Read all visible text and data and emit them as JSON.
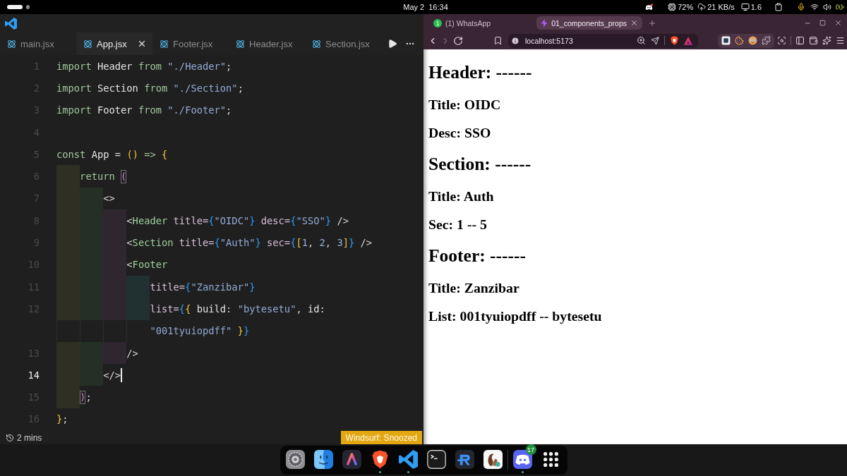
{
  "system_bar": {
    "workspaces": [
      {
        "selected": true
      },
      {
        "selected": false
      }
    ],
    "date": "May 2",
    "time": "16:34",
    "cpu": "72%",
    "network": "21 KB/s",
    "load": "1.6"
  },
  "editor": {
    "tabs": [
      {
        "label": "main.jsx",
        "selected": false
      },
      {
        "label": "App.jsx",
        "selected": true
      },
      {
        "label": "Footer.jsx",
        "selected": false
      },
      {
        "label": "Header.jsx",
        "selected": false
      },
      {
        "label": "Section.jsx",
        "selected": false
      }
    ],
    "lines": [
      {
        "number": "1",
        "current": false,
        "tokens": [
          {
            "kind": "keyword",
            "text": "import"
          },
          {
            "kind": "name",
            "text": " Header "
          },
          {
            "kind": "keyword",
            "text": "from"
          },
          {
            "kind": "string",
            "text": " \"./Header\""
          },
          {
            "kind": "punct",
            "text": ";"
          }
        ]
      },
      {
        "number": "2",
        "current": false,
        "tokens": [
          {
            "kind": "keyword",
            "text": "import"
          },
          {
            "kind": "name",
            "text": " Section "
          },
          {
            "kind": "keyword",
            "text": "from"
          },
          {
            "kind": "string",
            "text": " \"./Section\""
          },
          {
            "kind": "punct",
            "text": ";"
          }
        ]
      },
      {
        "number": "3",
        "current": false,
        "tokens": [
          {
            "kind": "keyword",
            "text": "import"
          },
          {
            "kind": "name",
            "text": " Footer "
          },
          {
            "kind": "keyword",
            "text": "from"
          },
          {
            "kind": "string",
            "text": " \"./Footer\""
          },
          {
            "kind": "punct",
            "text": ";"
          }
        ]
      },
      {
        "number": "4",
        "current": false
      },
      {
        "number": "5",
        "current": false,
        "tokens": [
          {
            "kind": "keyword",
            "text": "const"
          },
          {
            "kind": "name",
            "text": " App "
          },
          {
            "kind": "punct",
            "text": "= "
          },
          {
            "kind": "bracket1",
            "text": "()"
          },
          {
            "kind": "keyword",
            "text": " => "
          },
          {
            "kind": "bracket1",
            "text": "{"
          }
        ]
      },
      {
        "number": "6",
        "current": false,
        "guides": [
          {
            "color": "#2f2f23"
          }
        ],
        "tokens": [
          {
            "kind": "keyword",
            "text": "return "
          },
          {
            "kind": "match",
            "text": "("
          }
        ]
      },
      {
        "number": "7",
        "current": false,
        "guides": [
          {
            "color": "#2f2f23"
          },
          {
            "color": "#243026"
          }
        ],
        "tokens": [
          {
            "kind": "punct",
            "text": "<>"
          }
        ]
      },
      {
        "number": "8",
        "current": false,
        "guides": [
          {
            "color": "#2f2f23"
          },
          {
            "color": "#243026"
          },
          {
            "color": "#2f2630"
          }
        ],
        "tokens": [
          {
            "kind": "punct",
            "text": "<"
          },
          {
            "kind": "tag",
            "text": "Header"
          },
          {
            "kind": "attr",
            "text": " title="
          },
          {
            "kind": "bracket3",
            "text": "{"
          },
          {
            "kind": "string",
            "text": "\"OIDC\""
          },
          {
            "kind": "bracket3",
            "text": "}"
          },
          {
            "kind": "attr",
            "text": " desc="
          },
          {
            "kind": "bracket3",
            "text": "{"
          },
          {
            "kind": "string",
            "text": "\"SSO\""
          },
          {
            "kind": "bracket3",
            "text": "}"
          },
          {
            "kind": "punct",
            "text": " />"
          }
        ]
      },
      {
        "number": "9",
        "current": false,
        "guides": [
          {
            "color": "#2f2f23"
          },
          {
            "color": "#243026"
          },
          {
            "color": "#2f2630"
          }
        ],
        "tokens": [
          {
            "kind": "punct",
            "text": "<"
          },
          {
            "kind": "tag",
            "text": "Section"
          },
          {
            "kind": "attr",
            "text": " title="
          },
          {
            "kind": "bracket3",
            "text": "{"
          },
          {
            "kind": "string",
            "text": "\"Auth\""
          },
          {
            "kind": "bracket3",
            "text": "}"
          },
          {
            "kind": "attr",
            "text": " sec="
          },
          {
            "kind": "bracket3",
            "text": "{"
          },
          {
            "kind": "bracket1",
            "text": "["
          },
          {
            "kind": "number",
            "text": "1"
          },
          {
            "kind": "punct",
            "text": ", "
          },
          {
            "kind": "number",
            "text": "2"
          },
          {
            "kind": "punct",
            "text": ", "
          },
          {
            "kind": "number",
            "text": "3"
          },
          {
            "kind": "bracket1",
            "text": "]"
          },
          {
            "kind": "bracket3",
            "text": "}"
          },
          {
            "kind": "punct",
            "text": " />"
          }
        ]
      },
      {
        "number": "10",
        "current": false,
        "guides": [
          {
            "color": "#2f2f23"
          },
          {
            "color": "#243026"
          },
          {
            "color": "#2f2630"
          }
        ],
        "tokens": [
          {
            "kind": "punct",
            "text": "<"
          },
          {
            "kind": "tag",
            "text": "Footer"
          }
        ]
      },
      {
        "number": "11",
        "current": false,
        "guides": [
          {
            "color": "#2f2f23"
          },
          {
            "color": "#243026"
          },
          {
            "color": "#2f2630"
          },
          {
            "color": "#213030"
          }
        ],
        "tokens": [
          {
            "kind": "attr",
            "text": "title="
          },
          {
            "kind": "bracket3",
            "text": "{"
          },
          {
            "kind": "string",
            "text": "\"Zanzibar\""
          },
          {
            "kind": "bracket3",
            "text": "}"
          }
        ]
      },
      {
        "number": "12",
        "current": false,
        "guides": [
          {
            "color": "#2f2f23"
          },
          {
            "color": "#243026"
          },
          {
            "color": "#2f2630"
          },
          {
            "color": "#213030"
          }
        ],
        "tokens": [
          {
            "kind": "attr",
            "text": "list="
          },
          {
            "kind": "bracket3",
            "text": "{"
          },
          {
            "kind": "bracket1",
            "text": "{"
          },
          {
            "kind": "name",
            "text": " build"
          },
          {
            "kind": "punct",
            "text": ": "
          },
          {
            "kind": "string",
            "text": "\"bytesetu\""
          },
          {
            "kind": "punct",
            "text": ", "
          },
          {
            "kind": "name",
            "text": "id"
          },
          {
            "kind": "punct",
            "text": ":"
          }
        ],
        "wrap": [
          {
            "kind": "string",
            "text": "\"001tyuiopdff\""
          },
          {
            "kind": "bracket1",
            "text": " }"
          },
          {
            "kind": "bracket3",
            "text": "}"
          }
        ]
      },
      {
        "number": "13",
        "current": false,
        "guides": [
          {
            "color": "#2f2f23"
          },
          {
            "color": "#243026"
          },
          {
            "color": "#2f2630"
          }
        ],
        "tokens": [
          {
            "kind": "punct",
            "text": "/>"
          }
        ]
      },
      {
        "number": "14",
        "current": true,
        "guides": [
          {
            "color": "#2f2f23"
          },
          {
            "color": "#243026"
          }
        ],
        "tokens": [
          {
            "kind": "punct",
            "text": "</>"
          }
        ]
      },
      {
        "number": "15",
        "current": false,
        "guides": [
          {
            "color": "#2f2f23"
          }
        ],
        "tokens": [
          {
            "kind": "match",
            "text": ")"
          },
          {
            "kind": "punct",
            "text": ";"
          }
        ]
      },
      {
        "number": "16",
        "current": false,
        "tokens": [
          {
            "kind": "bracket1",
            "text": "}"
          },
          {
            "kind": "punct",
            "text": ";"
          }
        ]
      }
    ],
    "status": {
      "history": "2 mins",
      "badge": "Windsurf: Snoozed"
    }
  },
  "browser": {
    "tabs": [
      {
        "title": "(1) WhatsApp",
        "badge": "1",
        "selected": false
      },
      {
        "title": "01_components_props",
        "selected": true
      }
    ],
    "nav_buttons": [
      {
        "kind": "back",
        "disabled": false
      },
      {
        "kind": "forward",
        "disabled": true
      },
      {
        "kind": "reload",
        "disabled": false
      }
    ],
    "url": "localhost:5173",
    "page": [
      {
        "kind": "heading",
        "text": "Header: ------"
      },
      {
        "kind": "field",
        "text": "Title: OIDC"
      },
      {
        "kind": "field",
        "text": "Desc: SSO"
      },
      {
        "kind": "heading",
        "text": "Section: ------"
      },
      {
        "kind": "field",
        "text": "Title: Auth"
      },
      {
        "kind": "field",
        "text": "Sec: 1 -- 5"
      },
      {
        "kind": "heading",
        "text": "Footer: ------"
      },
      {
        "kind": "field",
        "text": "Title: Zanzibar"
      },
      {
        "kind": "field",
        "text": "List: 001tyuiopdff -- bytesetu"
      }
    ]
  },
  "dock": {
    "apps": [
      {
        "kind": "settings",
        "running": false
      },
      {
        "kind": "files",
        "running": false
      },
      {
        "kind": "launcher",
        "running": false
      },
      {
        "kind": "browser",
        "running": true
      },
      {
        "kind": "editor",
        "running": true
      },
      {
        "kind": "terminal",
        "running": false
      },
      {
        "kind": "client",
        "running": false
      },
      {
        "kind": "notes",
        "running": false
      },
      {
        "kind": "separator"
      },
      {
        "kind": "chat",
        "running": true,
        "badge": "17"
      },
      {
        "kind": "apps",
        "running": false
      }
    ]
  }
}
